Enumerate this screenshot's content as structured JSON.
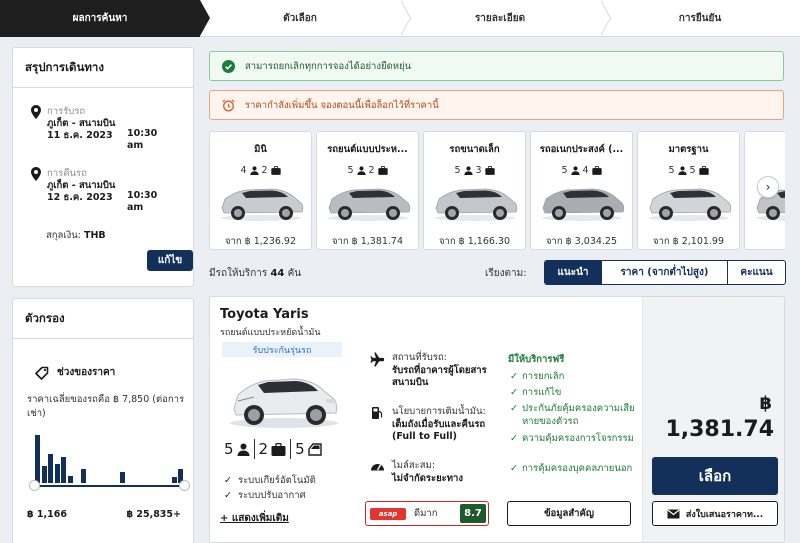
{
  "steps": [
    "ผลการค้นหา",
    "ตัวเลือก",
    "รายละเอียด",
    "การยืนยัน"
  ],
  "trip": {
    "title": "สรุปการเดินทาง",
    "pickup": {
      "label": "การรับรถ",
      "location": "ภูเก็ต - สนามบิน",
      "date": "11 ธ.ค. 2023",
      "time": "10:30 am"
    },
    "dropoff": {
      "label": "การคืนรถ",
      "location": "ภูเก็ต - สนามบิน",
      "date": "12 ธ.ค. 2023",
      "time": "10:30 am"
    },
    "currency_label": "สกุลเงิน:",
    "currency_value": "THB",
    "edit_label": "แก้ไข"
  },
  "filter": {
    "title": "ตัวกรอง",
    "price_range_title": "ช่วงของราคา",
    "avg_price_text": "ราคาเฉลี่ยของรถคือ ฿ 7,850 (ต่อการเช่า)",
    "min_price": "฿ 1,166",
    "max_price": "฿ 25,835+",
    "histogram": [
      1.0,
      0.35,
      0.6,
      0.4,
      0.55,
      0.15,
      0,
      0.3,
      0,
      0,
      0,
      0,
      0,
      0.22,
      0,
      0,
      0,
      0,
      0,
      0,
      0,
      0.12,
      0.3
    ]
  },
  "alerts": {
    "free_cancel": "สามารถยกเลิกทุกการจองได้อย่างยืดหยุ่น",
    "price_rising": "ราคากำลังเพิ่มขึ้น จองตอนนี้เพื่อล็อกไว้ที่ราคานี้"
  },
  "car_types": [
    {
      "name": "มินิ",
      "seats": "4",
      "bags": "2",
      "price": "จาก ฿ 1,236.92",
      "color": "#c8cbcf"
    },
    {
      "name": "รถยนต์แบบประห...",
      "seats": "5",
      "bags": "2",
      "price": "จาก ฿ 1,381.74",
      "color": "#b9bcc1"
    },
    {
      "name": "รถขนาดเล็ก",
      "seats": "5",
      "bags": "3",
      "price": "จาก ฿ 1,166.30",
      "color": "#c3c6ca"
    },
    {
      "name": "รถอเนกประสงค์ (...",
      "seats": "5",
      "bags": "4",
      "price": "จาก ฿ 3,034.25",
      "color": "#a9adb2"
    },
    {
      "name": "มาตรฐาน",
      "seats": "5",
      "bags": "5",
      "price": "จาก ฿ 2,101.99",
      "color": "#d2d4d7"
    },
    {
      "name": "รถ",
      "seats": "",
      "bags": "",
      "price": "จาก",
      "color": "#c1c4c8"
    }
  ],
  "results": {
    "count_prefix": "มีรถให้บริการ",
    "count": "44",
    "count_suffix": "คัน",
    "sort_label": "เรียงตาม:",
    "sort_options": [
      "แนะนำ",
      "ราคา (จากต่ำไปสูง)",
      "คะแนน"
    ]
  },
  "result": {
    "name": "Toyota Yaris",
    "category": "รถยนต์แบบประหยัดน้ำมัน",
    "badge": "รับประกันรุ่นรถ",
    "seats": "5",
    "bags": "2",
    "doors": "5",
    "features": [
      "ระบบเกียร์อัตโนมัติ",
      "ระบบปรับอากาศ"
    ],
    "more_link": "+ แสดงเพิ่มเติม",
    "pickup_label": "สถานที่รับรถ:",
    "pickup_value": "รับรถที่อาคารผู้โดยสารสนามบิน",
    "fuel_label": "นโยบายการเติมน้ำมัน:",
    "fuel_value": "เต็มถังเมื่อรับและคืนรถ (Full to Full)",
    "mileage_label": "ไมล์สะสม:",
    "mileage_value": "ไม่จำกัดระยะทาง",
    "included_title": "มีให้บริการฟรี",
    "included": [
      "การยกเลิก",
      "การแก้ไข",
      "ประกันภัยคุ้มครองความเสียหายของตัวรถ",
      "ความคุ้มครองการโจรกรรม",
      "การคุ้มครองบุคคลภายนอก"
    ],
    "supplier_logo": "asap",
    "supplier_rating_text": "ดีมาก",
    "supplier_score": "8.7",
    "key_info_label": "ข้อมูลสำคัญ",
    "currency_symbol": "฿",
    "price": "1,381.74",
    "select_label": "เลือก",
    "email_label": "ส่งใบเสนอราคาท..."
  },
  "colors": {
    "brand": "#12305a",
    "success": "#1c7a3a",
    "warning": "#b34918"
  }
}
